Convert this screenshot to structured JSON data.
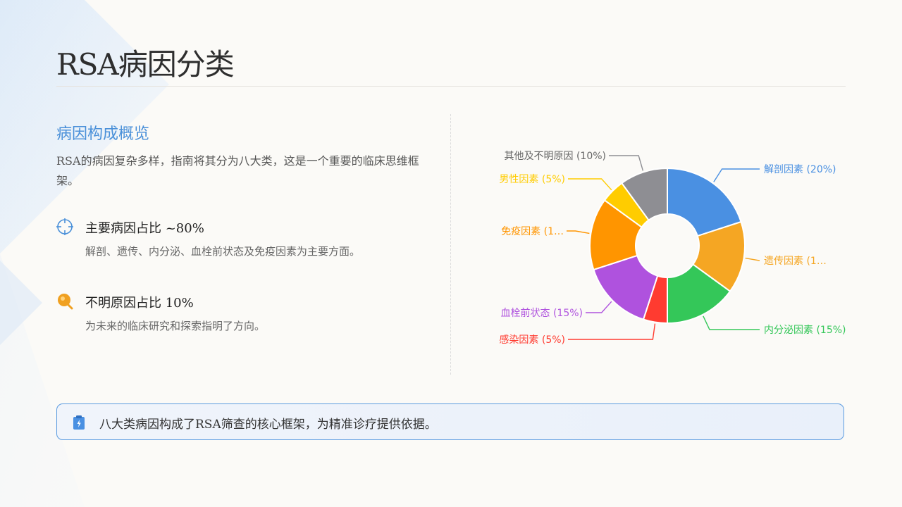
{
  "page": {
    "title": "RSA病因分类"
  },
  "overview": {
    "heading": "病因构成概览",
    "intro": "RSA的病因复杂多样，指南将其分为八大类，这是一个重要的临床思维框架。"
  },
  "points": [
    {
      "icon": "crosshair-icon",
      "title": "主要病因占比 ~80%",
      "desc": "解剖、遗传、内分泌、血栓前状态及免疫因素为主要方面。",
      "color": "#4a90d9"
    },
    {
      "icon": "search-icon",
      "title": "不明原因占比 10%",
      "desc": "为未来的临床研究和探索指明了方向。",
      "color": "#f0a020"
    }
  ],
  "chart_data": {
    "type": "pie",
    "variant": "donut",
    "title": "",
    "slices": [
      {
        "name": "解剖因素",
        "value": 20,
        "color": "#4a90e2",
        "label": "解剖因素 (20%)"
      },
      {
        "name": "遗传因素",
        "value": 15,
        "color": "#f5a623",
        "label": "遗传因素 (1…"
      },
      {
        "name": "内分泌因素",
        "value": 15,
        "color": "#34c759",
        "label": "内分泌因素 (15%)"
      },
      {
        "name": "感染因素",
        "value": 5,
        "color": "#ff3b30",
        "label": "感染因素 (5%)"
      },
      {
        "name": "血栓前状态",
        "value": 15,
        "color": "#af52de",
        "label": "血栓前状态 (15%)"
      },
      {
        "name": "免疫因素",
        "value": 15,
        "color": "#ff9500",
        "label": "免疫因素 (1…"
      },
      {
        "name": "男性因素",
        "value": 5,
        "color": "#ffcc00",
        "label": "男性因素 (5%)"
      },
      {
        "name": "其他及不明原因",
        "value": 10,
        "color": "#8e8e93",
        "label": "其他及不明原因 (10%)"
      }
    ],
    "label_colors": [
      "#4a90e2",
      "#f5a623",
      "#34c759",
      "#ff3b30",
      "#af52de",
      "#ff9500",
      "#ffcc00",
      "#666666"
    ]
  },
  "callout": {
    "icon": "clipboard-icon",
    "text": "八大类病因构成了RSA筛查的核心框架，为精准诊疗提供依据。"
  }
}
